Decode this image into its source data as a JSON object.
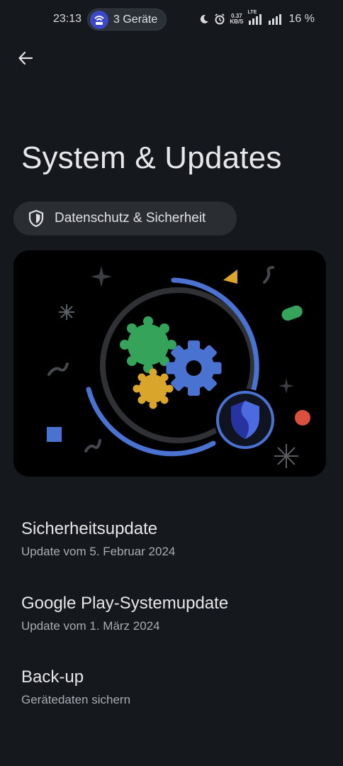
{
  "status_bar": {
    "time": "23:13",
    "hotspot_label": "3 Geräte",
    "speed_value": "0.37",
    "speed_unit": "KB/S",
    "network": "LTE",
    "battery": "16 %"
  },
  "header": {
    "title": "System & Updates"
  },
  "privacy_chip": {
    "label": "Datenschutz & Sicherheit"
  },
  "items": [
    {
      "title": "Sicherheitsupdate",
      "subtitle": "Update vom 5. Februar 2024"
    },
    {
      "title": "Google Play-Systemupdate",
      "subtitle": "Update vom 1. März 2024"
    },
    {
      "title": "Back-up",
      "subtitle": "Gerätedaten sichern"
    }
  ],
  "colors": {
    "background": "#15181c",
    "accent_blue": "#4a72d0",
    "green": "#35a35a",
    "yellow": "#d9a52a",
    "red": "#d9503f"
  }
}
